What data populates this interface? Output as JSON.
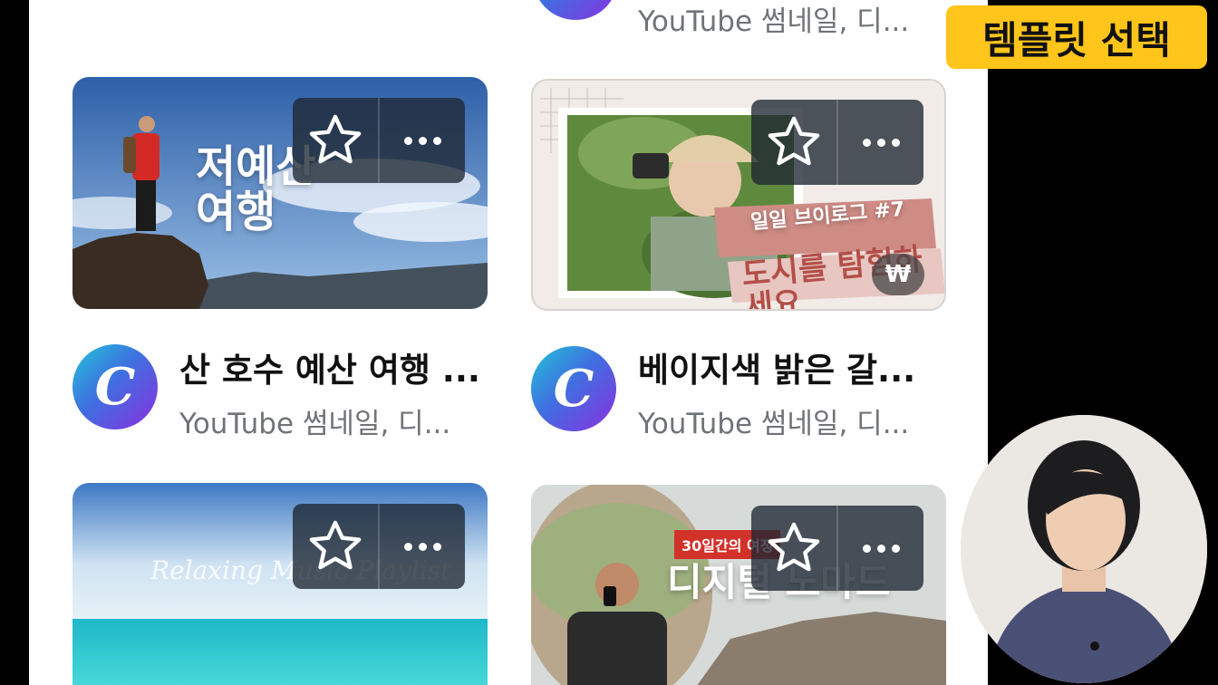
{
  "top_card": {
    "subtitle": "YouTube 썸네일, 디..."
  },
  "cards": [
    {
      "title": "산 호수 예산 여행 ...",
      "subtitle": "YouTube 썸네일, 디...",
      "thumb_text": [
        "저예산",
        "여행"
      ],
      "avatar_letter": "C",
      "star_icon": "star-icon",
      "more_icon": "more-icon"
    },
    {
      "title": "베이지색 밝은 갈...",
      "subtitle": "YouTube 썸네일, 디...",
      "thumb_label": "일일 브이로그 #7",
      "thumb_caption": "도시를 탐험하세요",
      "price_badge": "₩",
      "avatar_letter": "C"
    },
    {
      "thumb_text": "Relaxing Music Playlist"
    },
    {
      "thumb_label": "30일간의 여정",
      "thumb_caption": "디지털 노마드"
    }
  ],
  "overlay_tag": "템플릿 선택",
  "colors": {
    "tag_bg": "#ffc51a",
    "subtitle": "#707379",
    "avatar_from": "#22c5d8",
    "avatar_to": "#8a2fe0"
  }
}
